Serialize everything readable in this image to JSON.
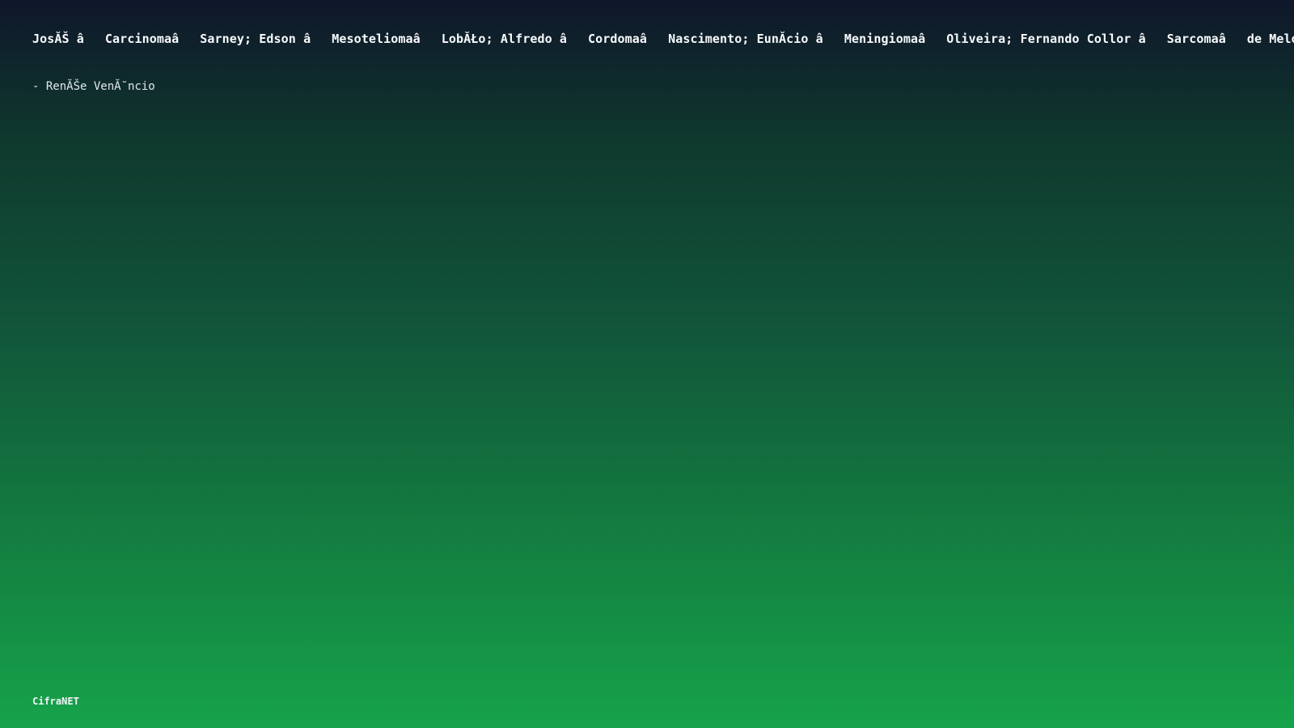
{
  "marquee": {
    "items": [
      "JosĂŠ â",
      "Carcinomaâ",
      "Sarney; Edson â",
      "Mesoteliomaâ",
      "LobĂŁo; Alfredo â",
      "Cordomaâ",
      "Nascimento; EunĂ­cio â",
      "Meningiomaâ",
      "Oliveira; Fernando Collor â",
      "Sarcomaâ",
      "de Melo; Gil"
    ]
  },
  "author": "- RenĂŠe VenĂ˘ncio",
  "brand": "CifraNET",
  "colors": {
    "gradient_top": "#0f172a",
    "gradient_bottom": "#16a34a",
    "text": "#ffffff"
  }
}
